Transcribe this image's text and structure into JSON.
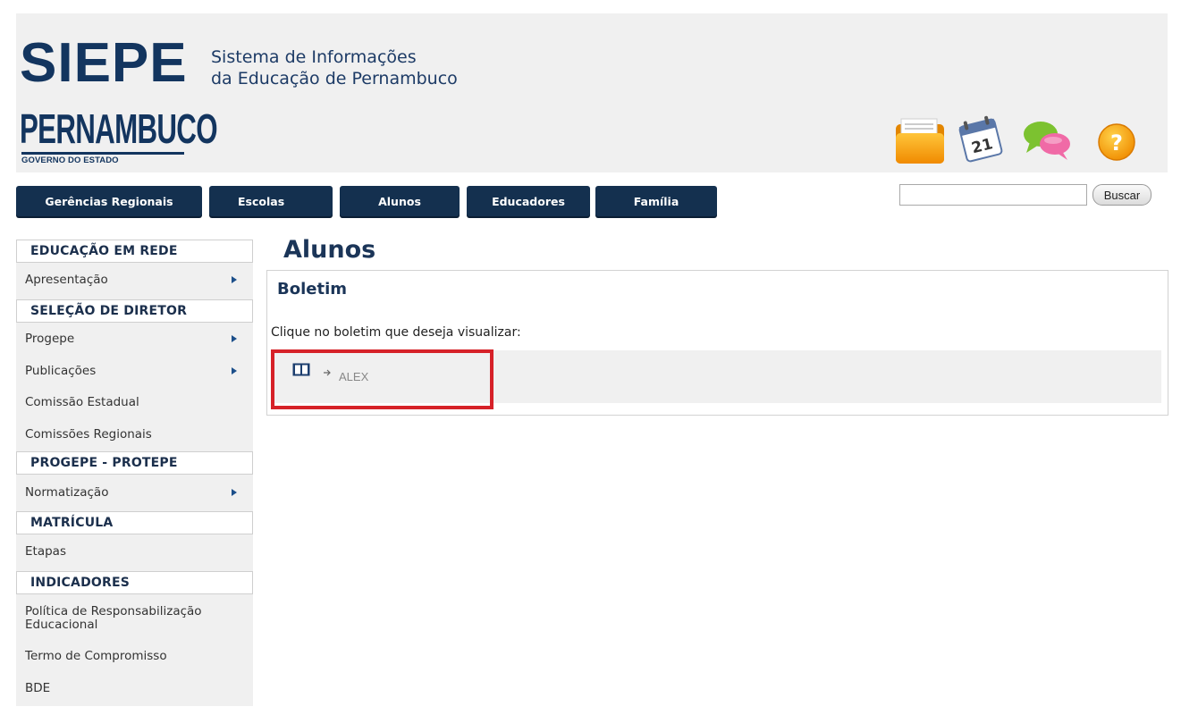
{
  "header": {
    "logo_text": "SIEPE",
    "subtitle_line1": "Sistema de Informações",
    "subtitle_line2": "da Educação de Pernambuco",
    "state_name": "PERNAMBUCO",
    "government_label": "GOVERNO DO ESTADO",
    "icons": [
      "folder-icon",
      "calendar-icon",
      "chat-icon",
      "help-icon"
    ],
    "calendar_day": "21",
    "help_symbol": "?"
  },
  "nav": {
    "items": [
      "Gerências Regionais",
      "Escolas",
      "Alunos",
      "Educadores",
      "Família"
    ]
  },
  "search": {
    "value": "",
    "button_label": "Buscar"
  },
  "sidebar": {
    "sections": [
      {
        "title": "EDUCAÇÃO EM REDE",
        "items": [
          {
            "label": "Apresentação",
            "has_submenu": true
          }
        ]
      },
      {
        "title": "SELEÇÃO DE DIRETOR",
        "items": [
          {
            "label": "Progepe",
            "has_submenu": true
          },
          {
            "label": "Publicações",
            "has_submenu": true
          },
          {
            "label": "Comissão Estadual",
            "has_submenu": false
          },
          {
            "label": "Comissões Regionais",
            "has_submenu": false
          }
        ]
      },
      {
        "title": "PROGEPE - PROTEPE",
        "items": [
          {
            "label": "Normatização",
            "has_submenu": true
          }
        ]
      },
      {
        "title": "MATRÍCULA",
        "items": [
          {
            "label": "Etapas",
            "has_submenu": false
          }
        ]
      },
      {
        "title": "INDICADORES",
        "items": [
          {
            "label": "Política de Responsabilização Educacional",
            "has_submenu": false
          },
          {
            "label": "Termo de Compromisso",
            "has_submenu": false
          },
          {
            "label": "BDE",
            "has_submenu": false
          }
        ]
      }
    ]
  },
  "main": {
    "page_title": "Alunos",
    "section_title": "Boletim",
    "instruction": "Clique no boletim que deseja visualizar:",
    "boletins": [
      {
        "student": "ALEX"
      }
    ]
  },
  "colors": {
    "navy": "#14304f",
    "title": "#1b3558",
    "highlight": "#d62128",
    "panel": "#f0f0f0"
  }
}
